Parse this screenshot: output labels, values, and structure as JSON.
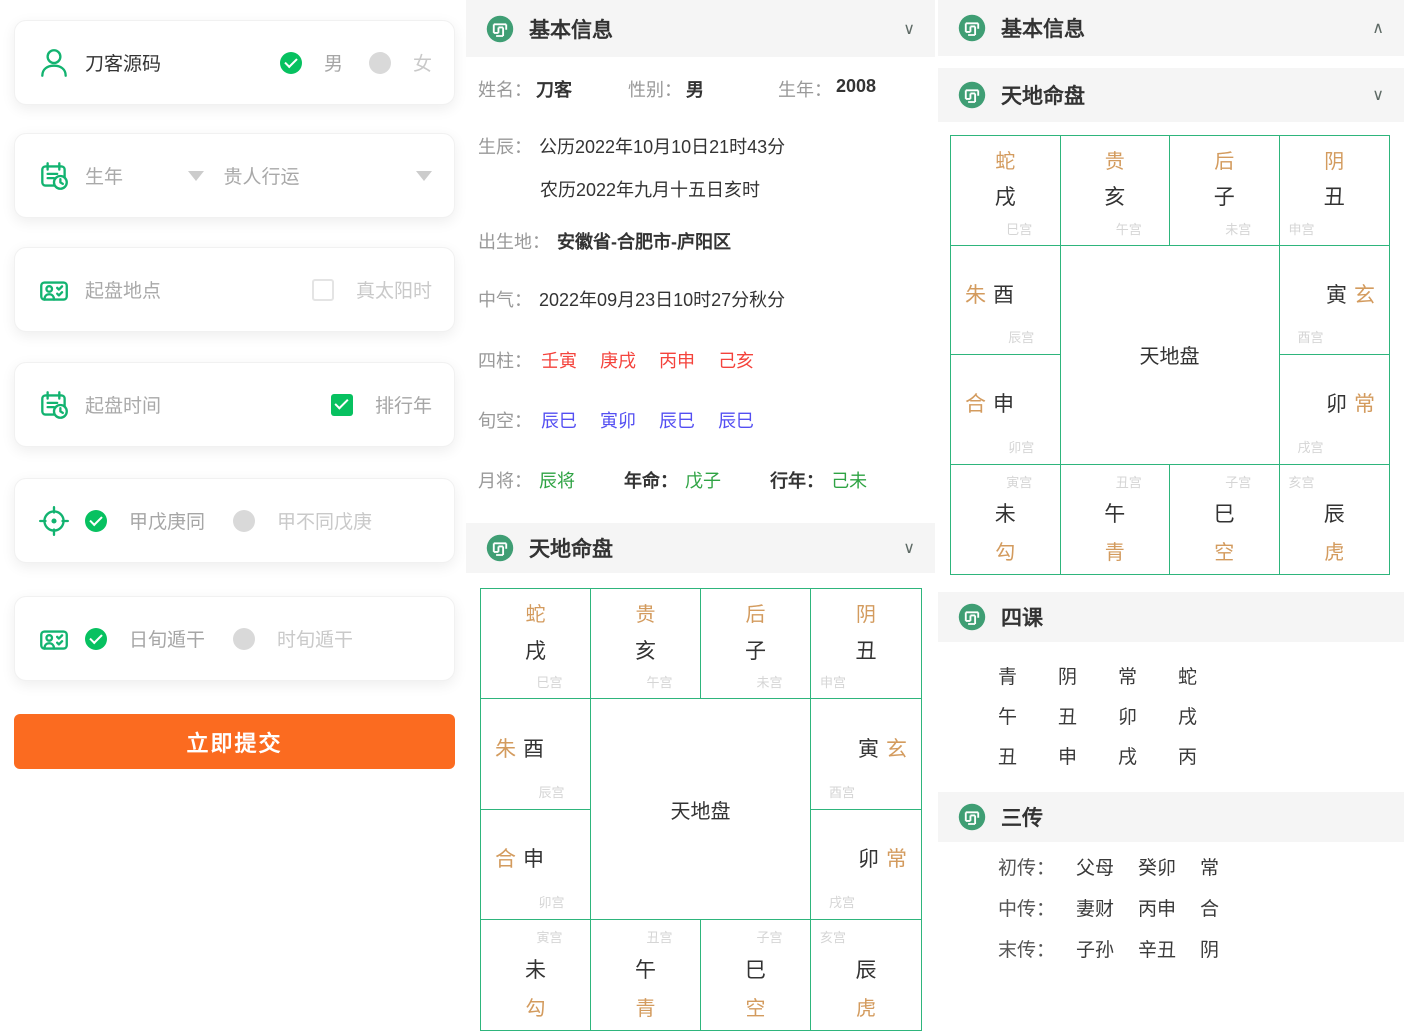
{
  "colors": {
    "accent_green": "#07c160",
    "icon_green": "#12b370",
    "chart_border_green": "#2eb57c",
    "accent_orange": "#fb6b20",
    "general_orange": "#d39b5e",
    "pillar_red": "#f4433c",
    "void_blue": "#544ff2",
    "luck_green": "#2fa344"
  },
  "icons": {
    "chevron_down": "∨",
    "chevron_up": "∧"
  },
  "sidebar": {
    "name": {
      "value": "刀客源码"
    },
    "gender": {
      "male": "男",
      "female": "女"
    },
    "year_row": {
      "year_placeholder": "生年",
      "luck_placeholder": "贵人行运"
    },
    "place_row": {
      "placeholder": "起盘地点",
      "solar_label": "真太阳时"
    },
    "time_row": {
      "placeholder": "起盘时间",
      "rank_label": "排行年"
    },
    "jia_row": {
      "opt1": "甲戊庚同",
      "opt2": "甲不同戊庚"
    },
    "dun_row": {
      "opt1": "日旬遁干",
      "opt2": "时旬遁干"
    },
    "submit": "立即提交"
  },
  "basic": {
    "title": "基本信息",
    "name_label": "姓名：",
    "name": "刀客",
    "gender_label": "性别：",
    "gender": "男",
    "year_label": "生年：",
    "year": "2008",
    "birth_label": "生辰：",
    "birth_solar": "公历2022年10月10日21时43分",
    "birth_lunar": "农历2022年九月十五日亥时",
    "place_label": "出生地：",
    "place": "安徽省-合肥市-庐阳区",
    "zhongqi_label": "中气：",
    "zhongqi": "2022年09月23日10时27分秋分",
    "sizhu_label": "四柱：",
    "sizhu": [
      "壬寅",
      "庚戌",
      "丙申",
      "己亥"
    ],
    "xunkong_label": "旬空：",
    "xunkong": [
      "辰巳",
      "寅卯",
      "辰巳",
      "辰巳"
    ],
    "yuejiang_label": "月将：",
    "yuejiang": "辰将",
    "nianming_label": "年命：",
    "nianming": "戊子",
    "xingnian_label": "行年：",
    "xingnian": "己未"
  },
  "chart": {
    "title": "天地命盘",
    "center": "天地盘",
    "top": [
      {
        "general": "蛇",
        "branch": "戌",
        "palace": "巳宫"
      },
      {
        "general": "贵",
        "branch": "亥",
        "palace": "午宫"
      },
      {
        "general": "后",
        "branch": "子",
        "palace": "未宫"
      },
      {
        "general": "阴",
        "branch": "丑",
        "palace": "申宫"
      }
    ],
    "left": [
      {
        "general": "朱",
        "branch": "酉",
        "palace": "辰宫"
      },
      {
        "general": "合",
        "branch": "申",
        "palace": "卯宫"
      }
    ],
    "right": [
      {
        "branch": "寅",
        "general": "玄",
        "palace": "酉宫"
      },
      {
        "branch": "卯",
        "general": "常",
        "palace": "戌宫"
      }
    ],
    "bottom": [
      {
        "palace": "寅宫",
        "branch": "未",
        "general": "勾"
      },
      {
        "palace": "丑宫",
        "branch": "午",
        "general": "青"
      },
      {
        "palace": "子宫",
        "branch": "巳",
        "general": "空"
      },
      {
        "palace": "亥宫",
        "branch": "辰",
        "general": "虎"
      }
    ]
  },
  "sike": {
    "title": "四课",
    "rows": [
      [
        "青",
        "阴",
        "常",
        "蛇"
      ],
      [
        "午",
        "丑",
        "卯",
        "戌"
      ],
      [
        "丑",
        "申",
        "戌",
        "丙"
      ]
    ]
  },
  "sanchuan": {
    "title": "三传",
    "rows": [
      {
        "label": "初传：",
        "relation": "父母",
        "ganzhi": "癸卯",
        "general": "常"
      },
      {
        "label": "中传：",
        "relation": "妻财",
        "ganzhi": "丙申",
        "general": "合"
      },
      {
        "label": "末传：",
        "relation": "子孙",
        "ganzhi": "辛丑",
        "general": "阴"
      }
    ]
  }
}
